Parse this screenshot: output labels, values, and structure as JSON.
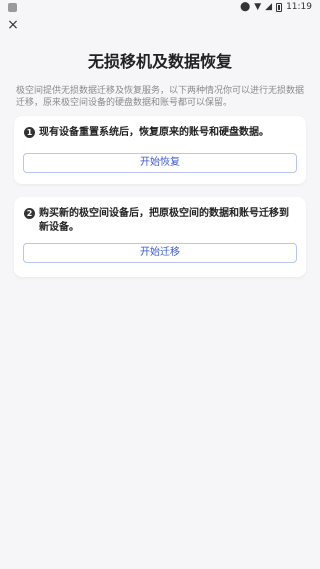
{
  "status_bar": {
    "time": "11:19",
    "icons": [
      "app-icon",
      "location-icon",
      "wifi-icon",
      "signal-icon",
      "battery-icon"
    ]
  },
  "header": {
    "close_icon": "close-icon",
    "close_glyph": "×",
    "title": "无损移机及数据恢复"
  },
  "description": "极空间提供无损数据迁移及恢复服务，以下两种情况你可以进行无损数据迁移，原来极空间设备的硬盘数据和账号都可以保留。",
  "cards": [
    {
      "number": "1",
      "text": "现有设备重置系统后，恢复原来的账号和硬盘数据。",
      "button_label": "开始恢复"
    },
    {
      "number": "2",
      "text": "购买新的极空间设备后，把原极空间的数据和账号迁移到新设备。",
      "button_label": "开始迁移"
    }
  ],
  "colors": {
    "background": "#f6f6f8",
    "card": "#ffffff",
    "accent": "#3b5bdb",
    "button_border": "#b9c4f2"
  }
}
